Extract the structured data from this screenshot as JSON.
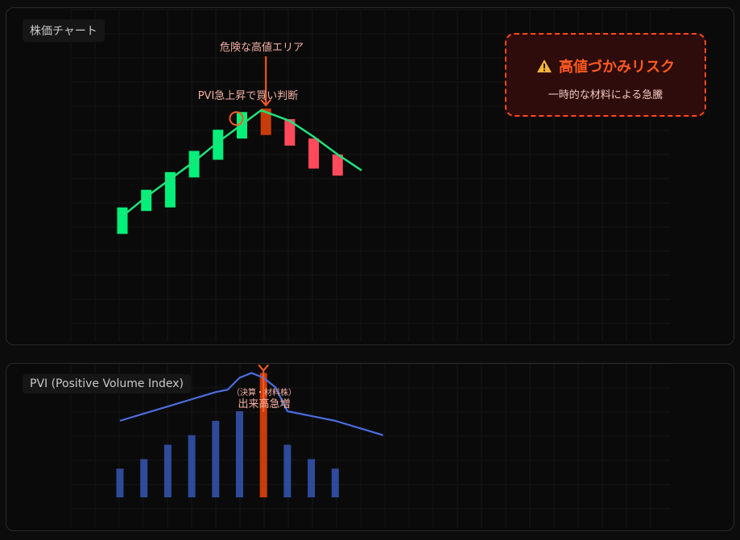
{
  "price_panel": {
    "label": "株価チャート",
    "annotation_peak": "危険な高値エリア",
    "annotation_signal": "PVI急上昇で買い判断",
    "risk": {
      "title": "高値づかみリスク",
      "subtitle": "一時的な材料による急騰",
      "icon": "warning-icon"
    }
  },
  "pvi_panel": {
    "label": "PVI (Positive Volume Index)",
    "annotation_small": "（決算・材料株）",
    "annotation_main": "出来高急増"
  },
  "colors": {
    "up": "#00f07a",
    "down": "#ff4a5c",
    "highlight": "#c83c0a",
    "arrow": "#ff5a1e",
    "pvi_line": "#4a6ee0",
    "volume": "#2e4a9a",
    "trend_line": "#22e27a"
  },
  "chart_data": [
    {
      "type": "candlestick",
      "title": "株価チャート",
      "candles": [
        {
          "open": 30,
          "close": 45,
          "dir": "up"
        },
        {
          "open": 43,
          "close": 55,
          "dir": "up"
        },
        {
          "open": 45,
          "close": 65,
          "dir": "up"
        },
        {
          "open": 62,
          "close": 77,
          "dir": "up"
        },
        {
          "open": 72,
          "close": 89,
          "dir": "up"
        },
        {
          "open": 84,
          "close": 99,
          "dir": "up"
        },
        {
          "open": 101,
          "close": 86,
          "dir": "highlight"
        },
        {
          "open": 95,
          "close": 80,
          "dir": "down"
        },
        {
          "open": 84,
          "close": 67,
          "dir": "down"
        },
        {
          "open": 75,
          "close": 63,
          "dir": "down"
        }
      ],
      "trend": [
        [
          0,
          40
        ],
        [
          1,
          51
        ],
        [
          2,
          61
        ],
        [
          3,
          71
        ],
        [
          4,
          82
        ],
        [
          5,
          92
        ],
        [
          5.8,
          100
        ],
        [
          7,
          94
        ],
        [
          8,
          85
        ],
        [
          9,
          75
        ],
        [
          10,
          66
        ]
      ],
      "ylim": [
        0,
        138
      ],
      "signal_index": 5
    },
    {
      "type": "bar+line",
      "title": "PVI (Positive Volume Index)",
      "volumes": [
        6,
        8,
        11,
        13,
        16,
        18,
        26,
        11,
        8,
        6
      ],
      "highlight_index": 6,
      "pvi_line": [
        [
          0,
          16
        ],
        [
          1,
          17.5
        ],
        [
          2,
          19
        ],
        [
          3,
          20.5
        ],
        [
          4,
          22
        ],
        [
          4.5,
          22.5
        ],
        [
          5,
          25
        ],
        [
          5.5,
          26
        ],
        [
          6,
          25
        ],
        [
          6.5,
          23
        ],
        [
          7,
          18
        ],
        [
          8,
          17
        ],
        [
          9,
          16
        ],
        [
          10,
          14.5
        ],
        [
          11,
          13
        ]
      ],
      "ylim": [
        0,
        40
      ]
    }
  ]
}
